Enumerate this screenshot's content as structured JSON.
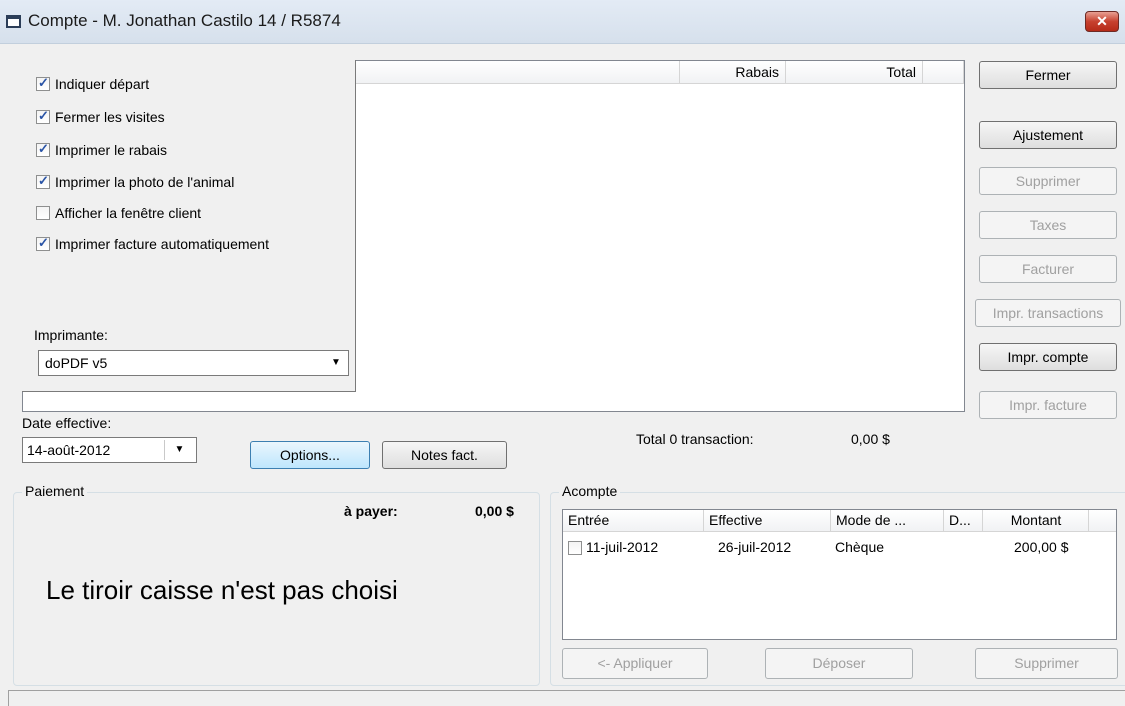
{
  "window": {
    "title": "Compte - M. Jonathan Castilo 14 / R5874",
    "close_glyph": "✕"
  },
  "list": {
    "headers": [
      "Rabais",
      "Total"
    ]
  },
  "options_panel": {
    "checkboxes": [
      {
        "label": "Indiquer départ",
        "checked": true
      },
      {
        "label": "Fermer les visites",
        "checked": true
      },
      {
        "label": "Imprimer le rabais",
        "checked": true
      },
      {
        "label": "Imprimer la photo de l'animal",
        "checked": true
      },
      {
        "label": "Afficher la fenêtre client",
        "checked": false
      },
      {
        "label": "Imprimer facture automatiquement",
        "checked": true
      }
    ],
    "printer_label": "Imprimante:",
    "printer_value": "doPDF v5"
  },
  "side_buttons": [
    {
      "label": "Fermer",
      "enabled": true
    },
    {
      "label": "Ajustement",
      "enabled": true
    },
    {
      "label": "Supprimer",
      "enabled": false
    },
    {
      "label": "Taxes",
      "enabled": false
    },
    {
      "label": "Facturer",
      "enabled": false
    },
    {
      "label": "Impr. transactions",
      "enabled": false
    },
    {
      "label": "Impr. compte",
      "enabled": true
    },
    {
      "label": "Impr. facture",
      "enabled": false
    }
  ],
  "date_effective": {
    "label": "Date effective:",
    "value": "14-août-2012"
  },
  "buttons": {
    "options": "Options...",
    "notes": "Notes fact."
  },
  "totals": {
    "label": "Total 0 transaction:",
    "value": "0,00 $"
  },
  "paiement": {
    "legend": "Paiement",
    "a_payer_label": "à payer:",
    "a_payer_value": "0,00 $",
    "message": "Le tiroir caisse n'est pas choisi"
  },
  "acompte": {
    "legend": "Acompte",
    "columns": [
      "Entrée",
      "Effective",
      "Mode de ...",
      "D...",
      "Montant"
    ],
    "rows": [
      {
        "checked": false,
        "entree": "11-juil-2012",
        "effective": "26-juil-2012",
        "mode": "Chèque",
        "d": "",
        "montant": "200,00 $"
      }
    ],
    "buttons": [
      {
        "label": "<- Appliquer",
        "enabled": false
      },
      {
        "label": "Déposer",
        "enabled": false
      },
      {
        "label": "Supprimer",
        "enabled": false
      }
    ]
  }
}
